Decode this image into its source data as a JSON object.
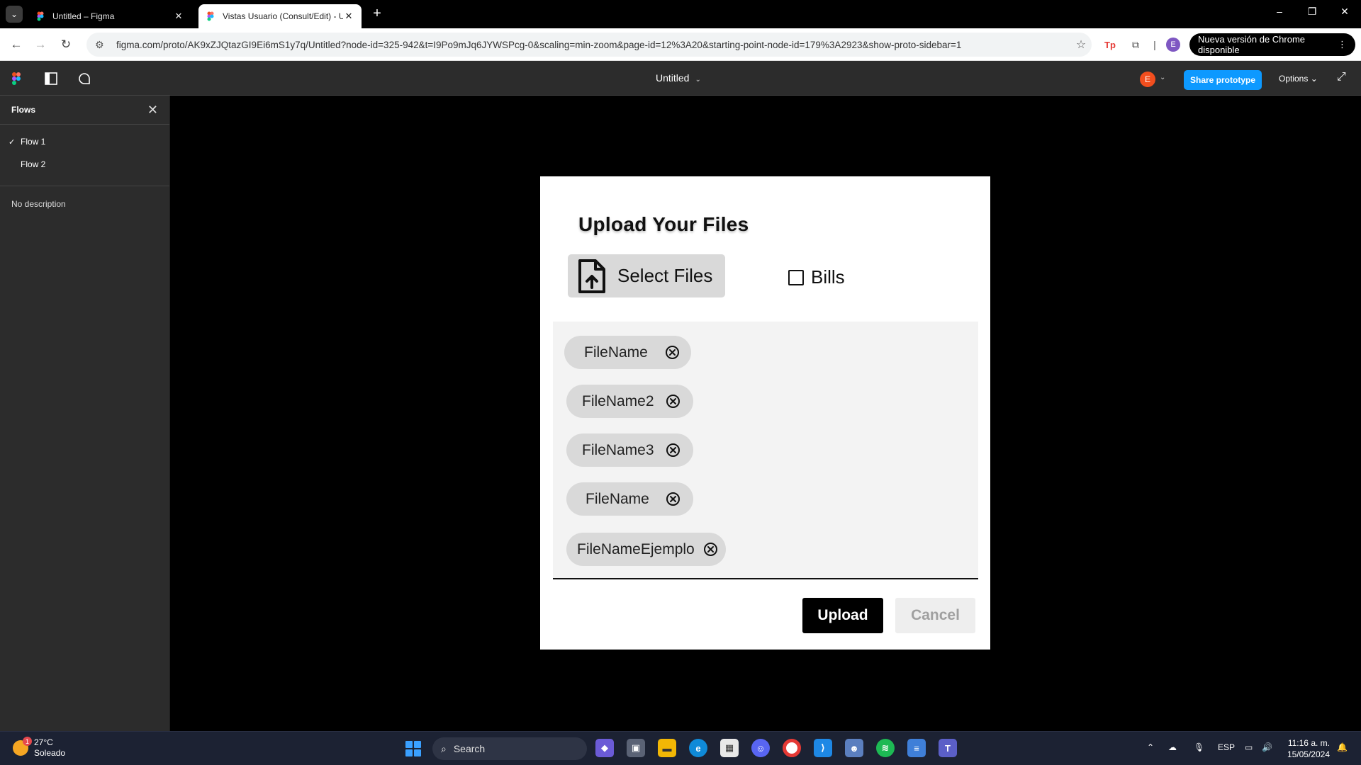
{
  "browser": {
    "tabs": [
      {
        "title": "Untitled – Figma",
        "active": false
      },
      {
        "title": "Vistas Usuario (Consult/Edit) - U",
        "active": true
      }
    ],
    "url": "figma.com/proto/AK9xZJQtazGI9Ei6mS1y7q/Untitled?node-id=325-942&t=I9Po9mJq6JYWSPcg-0&scaling=min-zoom&page-id=12%3A20&starting-point-node-id=179%3A2923&show-proto-sidebar=1",
    "profile_initial": "E",
    "update_label": "Nueva versión de Chrome disponible"
  },
  "figma": {
    "doc_title": "Untitled",
    "avatar_initial": "E",
    "share_label": "Share prototype",
    "options_label": "Options"
  },
  "sidebar": {
    "title": "Flows",
    "flows": [
      {
        "label": "Flow 1",
        "selected": true
      },
      {
        "label": "Flow 2",
        "selected": false
      }
    ],
    "description": "No description"
  },
  "modal": {
    "title": "Upload Your Files",
    "select_label": "Select Files",
    "checkbox_label": "Bills",
    "checkbox_checked": false,
    "files": [
      "FileName",
      "FileName2",
      "FileName3",
      "FileName",
      "FileNameEjemplo"
    ],
    "upload_label": "Upload",
    "cancel_label": "Cancel"
  },
  "taskbar": {
    "weather_temp": "27°C",
    "weather_desc": "Soleado",
    "weather_badge": "1",
    "search_label": "Search",
    "language": "ESP",
    "time": "11:16 a. m.",
    "date": "15/05/2024"
  }
}
